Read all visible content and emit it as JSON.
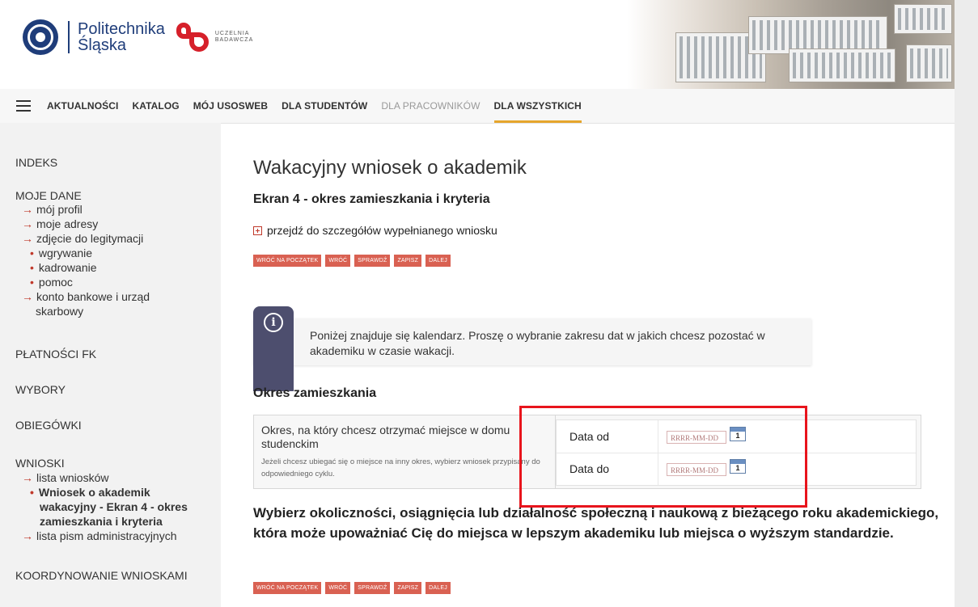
{
  "header": {
    "logo_line1": "Politechnika",
    "logo_line2": "Śląska",
    "uczelnia_line1": "UCZELNIA",
    "uczelnia_line2": "BADAWCZA"
  },
  "nav": {
    "items": [
      {
        "label": "AKTUALNOŚCI"
      },
      {
        "label": "KATALOG"
      },
      {
        "label": "MÓJ USOSWEB"
      },
      {
        "label": "DLA STUDENTÓW"
      },
      {
        "label": "DLA PRACOWNIKÓW"
      },
      {
        "label": "DLA WSZYSTKICH"
      }
    ]
  },
  "sidebar": {
    "indeks": "INDEKS",
    "moje_dane": "MOJE DANE",
    "moj_profil": "mój profil",
    "moje_adresy": "moje adresy",
    "zdjecie": "zdjęcie do legitymacji",
    "wgrywanie": "wgrywanie",
    "kadrowanie": "kadrowanie",
    "pomoc": "pomoc",
    "konto_1": "konto bankowe i urząd",
    "konto_2": "skarbowy",
    "platnosci": "PŁATNOŚCI FK",
    "wybory": "WYBORY",
    "obiegowki": "OBIEGÓWKI",
    "wnioski": "WNIOSKI",
    "lista_wnioskow": "lista wniosków",
    "wniosek_1": "Wniosek o akademik",
    "wniosek_2": "wakacyjny - Ekran 4 - okres",
    "wniosek_3": "zamieszkania i kryteria",
    "lista_pism": "lista pism administracyjnych",
    "koordynowanie": "KOORDYNOWANIE WNIOSKAMI"
  },
  "main": {
    "title": "Wakacyjny wniosek o akademik",
    "subtitle": "Ekran 4 - okres zamieszkania i kryteria",
    "details_link": "przejdź do szczegółów wypełnianego wniosku",
    "buttons": {
      "start": "WRÓĆ NA POCZĄTEK",
      "back": "WRÓĆ",
      "check": "SPRAWDŹ",
      "save": "ZAPISZ",
      "next": "DALEJ"
    },
    "info_text": "Poniżej znajduje się kalendarz. Proszę o wybranie zakresu dat w jakich chcesz pozostać w akademiku w czasie wakacji.",
    "okres_title": "Okres zamieszkania",
    "okres_question": "Okres, na który chcesz otrzymać miejsce w domu studenckim",
    "okres_note": "Jeżeli chcesz ubiegać się o miejsce na inny okres, wybierz wniosek przypisany do odpowiedniego cyklu.",
    "date_from_label": "Data od",
    "date_to_label": "Data do",
    "date_placeholder": "RRRR-MM-DD",
    "calendar_day": "1",
    "criteria_text": "Wybierz okoliczności, osiągnięcia lub działalność społeczną i naukową z bieżącego roku akademickiego, która może upoważniać Cię do miejsca w lepszym akademiku lub miejsca o wyższym standardzie."
  }
}
